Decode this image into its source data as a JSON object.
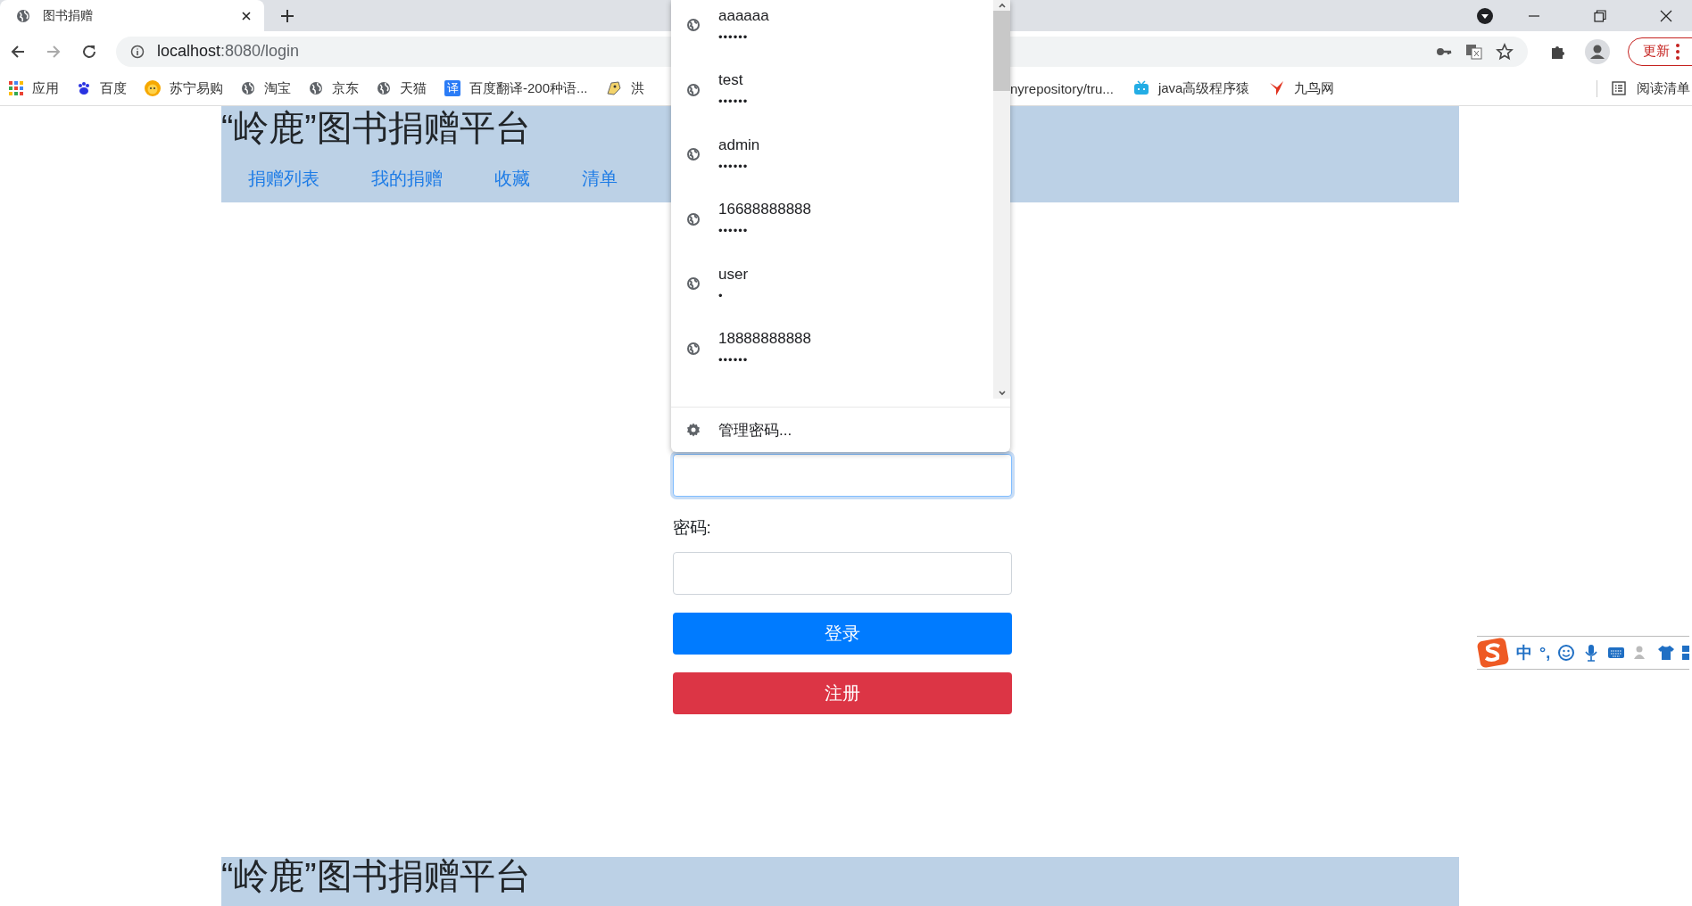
{
  "browser": {
    "tab": {
      "title": "图书捐赠",
      "selected": true
    },
    "url_host": "localhost",
    "url_rest": ":8080/login",
    "update_button": "更新",
    "bookmarks": [
      {
        "label": "应用",
        "kind": "apps"
      },
      {
        "label": "百度",
        "kind": "paw"
      },
      {
        "label": "苏宁易购",
        "kind": "lion"
      },
      {
        "label": "淘宝",
        "kind": "globe"
      },
      {
        "label": "京东",
        "kind": "globe"
      },
      {
        "label": "天猫",
        "kind": "globe"
      },
      {
        "label": "百度翻译-200种语...",
        "kind": "translate",
        "icon_text": "译"
      },
      {
        "label": "洪",
        "kind": "dragon"
      }
    ],
    "bookmarks_right": [
      {
        "label": "nyrepository/tru...",
        "kind": "none"
      },
      {
        "label": "java高级程序猿",
        "kind": "tv"
      },
      {
        "label": "九鸟网",
        "kind": "bird"
      }
    ],
    "reading_list": "阅读清单"
  },
  "page": {
    "title": "“岭鹿”图书捐赠平台",
    "nav": [
      "捐赠列表",
      "我的捐赠",
      "收藏",
      "清单"
    ],
    "username_field": {
      "focused": true
    },
    "password_label": "密码:",
    "buttons": [
      {
        "label": "登录",
        "kind": "primary"
      },
      {
        "label": "注册",
        "kind": "danger"
      }
    ],
    "footer_title": "“岭鹿”图书捐赠平台"
  },
  "autofill": {
    "entries": [
      {
        "username": "aaaaaa",
        "password": "••••••"
      },
      {
        "username": "test",
        "password": "••••••"
      },
      {
        "username": "admin",
        "password": "••••••"
      },
      {
        "username": "16688888888",
        "password": "••••••"
      },
      {
        "username": "user",
        "password": "•"
      },
      {
        "username": "18888888888",
        "password": "••••••"
      }
    ],
    "manage": "管理密码..."
  },
  "ime": {
    "mode": "中",
    "punct": "°,"
  }
}
